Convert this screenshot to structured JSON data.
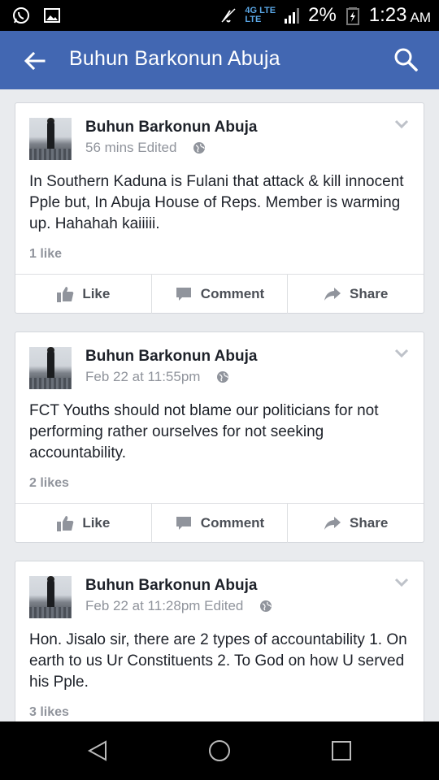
{
  "status_bar": {
    "network_top": "4G LTE",
    "network_bottom": "LTE",
    "battery": "2%",
    "time": "1:23",
    "ampm": "AM"
  },
  "app_bar": {
    "title": "Buhun Barkonun Abuja"
  },
  "posts": [
    {
      "author": "Buhun Barkonun Abuja",
      "meta": "56 mins Edited",
      "text": "In Southern Kaduna is Fulani that attack & kill innocent Pple but, In Abuja House of Reps. Member is warming up. Hahahah kaiiiii.",
      "likes": "1 like"
    },
    {
      "author": "Buhun Barkonun Abuja",
      "meta": "Feb 22 at 11:55pm",
      "text": "FCT Youths should not blame our politicians for not performing rather ourselves for not seeking accountability.",
      "likes": "2 likes"
    },
    {
      "author": "Buhun Barkonun Abuja",
      "meta": "Feb 22 at 11:28pm Edited",
      "text": "Hon. Jisalo sir, there are 2 types of accountability 1. On earth to us Ur Constituents 2. To God on how U served his Pple.",
      "likes": "3 likes"
    }
  ],
  "actions": {
    "like": "Like",
    "comment": "Comment",
    "share": "Share"
  },
  "colors": {
    "brand": "#4267b2",
    "status_bar": "#000000",
    "feed_background": "#e9ebee",
    "secondary_text": "#90949c"
  },
  "icons": {
    "status_left": [
      "whatsapp-icon",
      "image-icon"
    ],
    "status_right": [
      "mute-icon",
      "signal-icon",
      "battery-icon"
    ],
    "app_bar": [
      "back-arrow-icon",
      "search-icon"
    ],
    "post": [
      "globe-icon",
      "chevron-down-icon",
      "thumbs-up-icon",
      "comment-icon",
      "share-icon"
    ],
    "nav": [
      "back-triangle-icon",
      "home-circle-icon",
      "recents-square-icon"
    ]
  }
}
